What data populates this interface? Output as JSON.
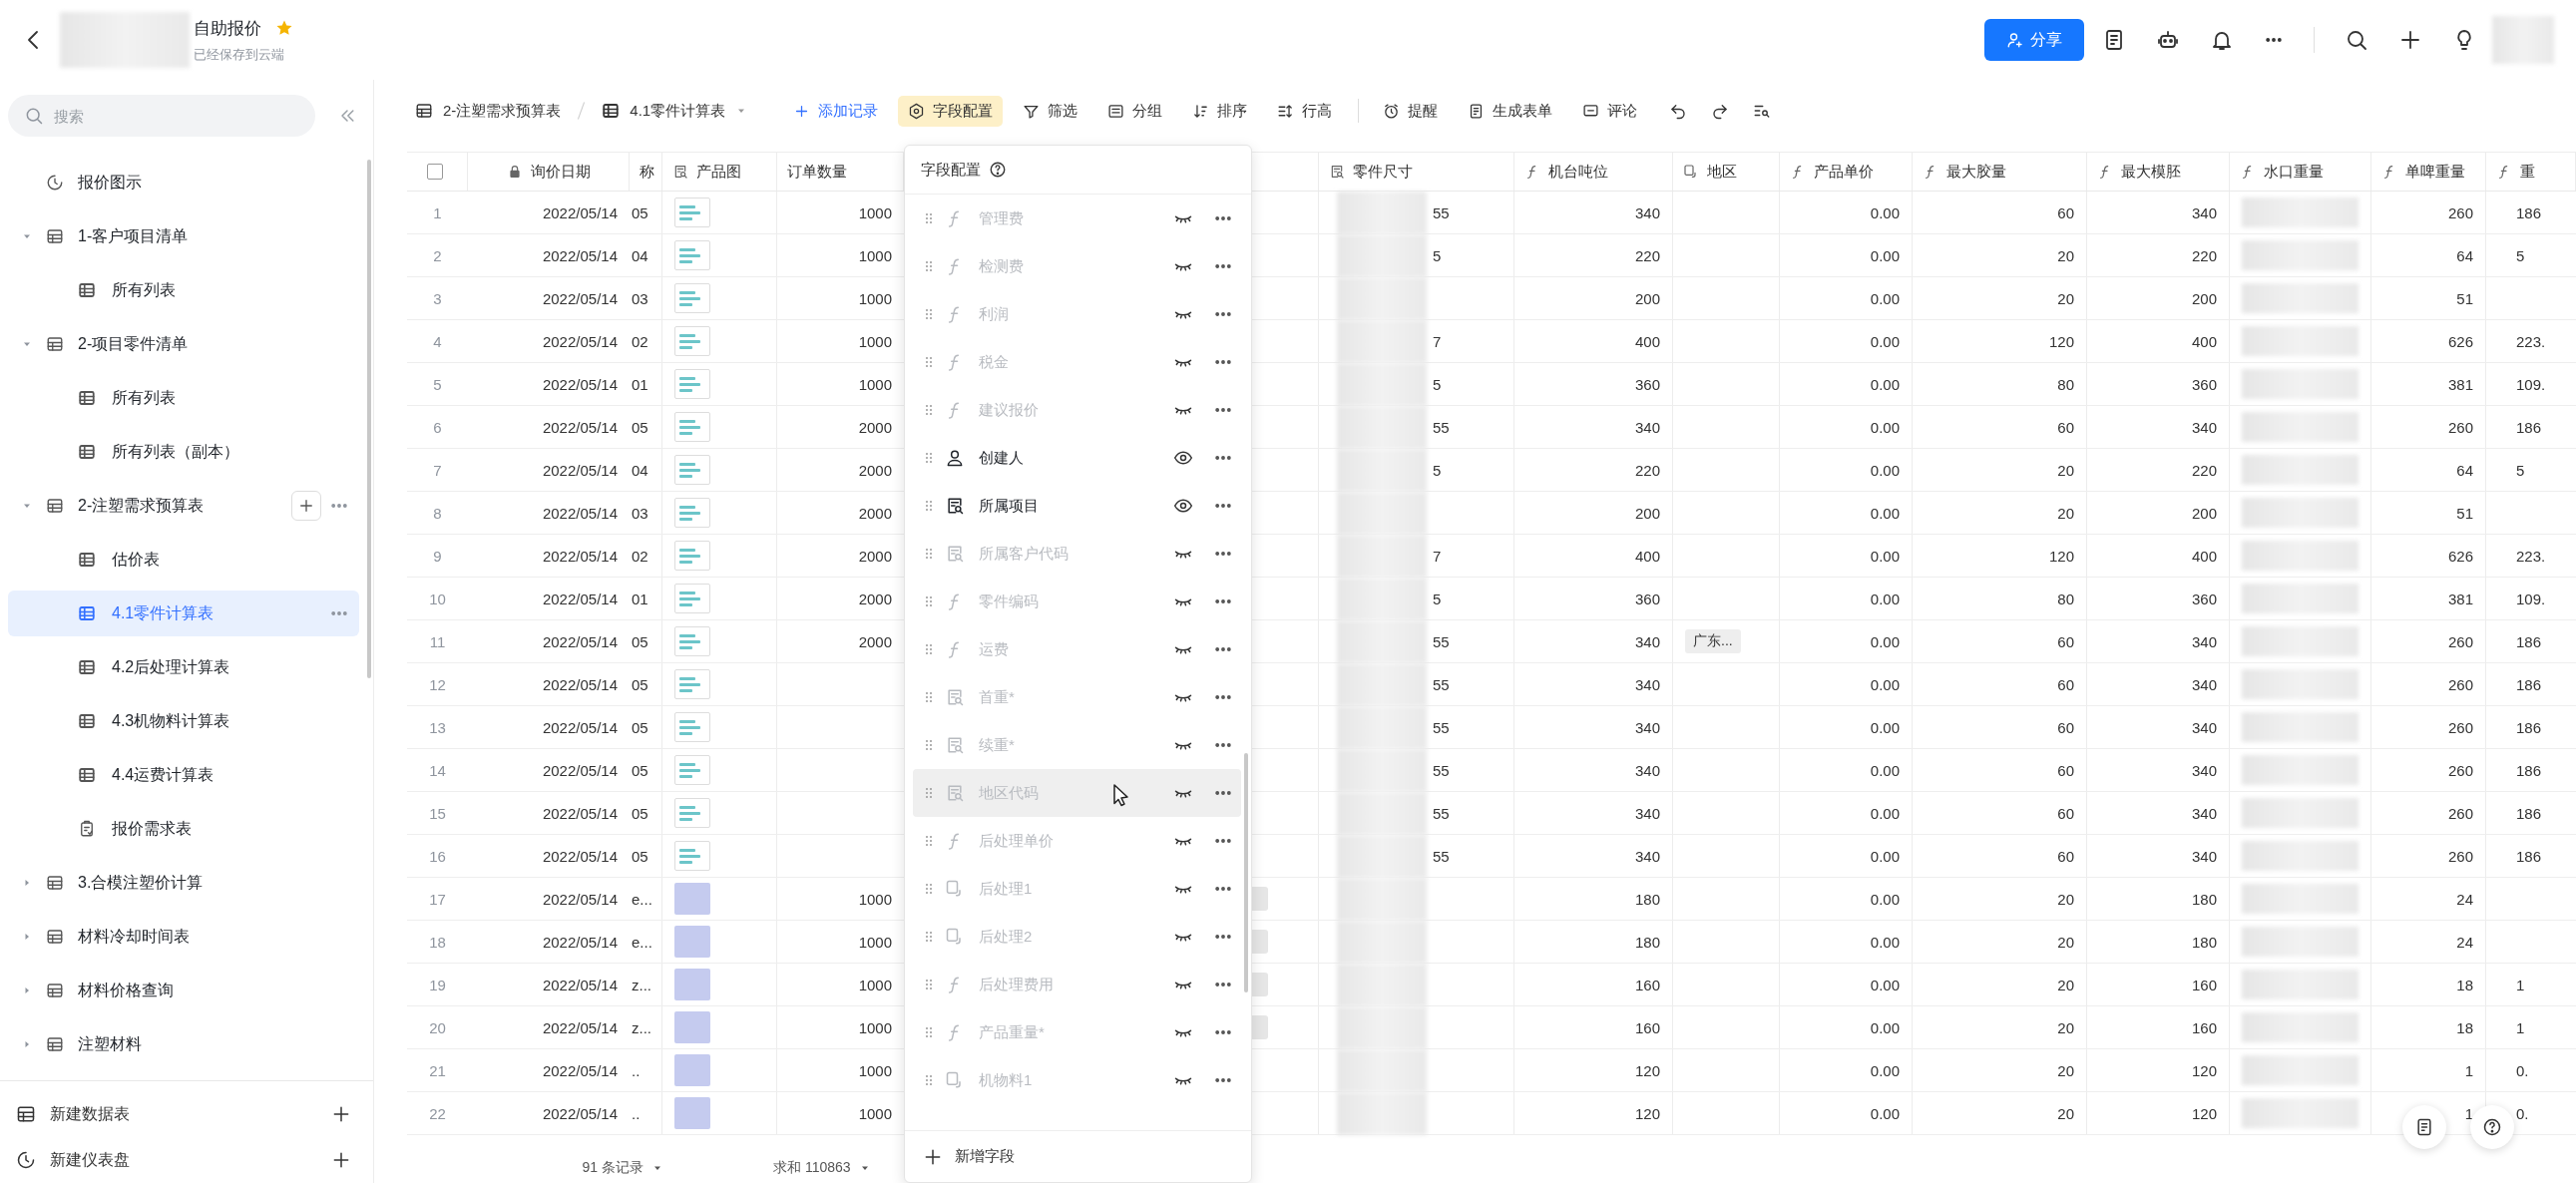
{
  "topbar": {
    "title": "自助报价",
    "starred": true,
    "subtitle": "已经保存到云端",
    "share_button": "分享"
  },
  "sidebar": {
    "search": {
      "placeholder": "搜索"
    },
    "items": [
      {
        "label": "报价图示",
        "kind": "dashboard",
        "selected": false,
        "hovered": false
      },
      {
        "label": "1-客户项目清单",
        "kind": "table",
        "expanded": true,
        "selected": false,
        "hovered": false,
        "children": [
          {
            "label": "所有列表",
            "kind": "view",
            "selected": false,
            "hovered": false
          }
        ]
      },
      {
        "label": "2-项目零件清单",
        "kind": "table",
        "expanded": true,
        "selected": false,
        "hovered": false,
        "children": [
          {
            "label": "所有列表",
            "kind": "view",
            "selected": false,
            "hovered": false
          },
          {
            "label": "所有列表（副本）",
            "kind": "view",
            "selected": false,
            "hovered": false
          }
        ]
      },
      {
        "label": "2-注塑需求预算表",
        "kind": "table",
        "expanded": true,
        "selected": false,
        "hovered": true,
        "children": [
          {
            "label": "估价表",
            "kind": "view",
            "selected": false,
            "hovered": false
          },
          {
            "label": "4.1零件计算表",
            "kind": "view",
            "selected": true,
            "hovered": false
          },
          {
            "label": "4.2后处理计算表",
            "kind": "view",
            "selected": false,
            "hovered": false
          },
          {
            "label": "4.3机物料计算表",
            "kind": "view",
            "selected": false,
            "hovered": false
          },
          {
            "label": "4.4运费计算表",
            "kind": "view",
            "selected": false,
            "hovered": false
          },
          {
            "label": "报价需求表",
            "kind": "form",
            "selected": false,
            "hovered": false
          }
        ]
      },
      {
        "label": "3.合模注塑价计算",
        "kind": "table",
        "expanded": false,
        "selected": false,
        "hovered": false
      },
      {
        "label": "材料冷却时间表",
        "kind": "table",
        "expanded": false,
        "selected": false,
        "hovered": false
      },
      {
        "label": "材料价格查询",
        "kind": "table",
        "expanded": false,
        "selected": false,
        "hovered": false
      },
      {
        "label": "注塑材料",
        "kind": "table",
        "expanded": false,
        "selected": false,
        "hovered": false
      }
    ],
    "footer": [
      {
        "label": "新建数据表",
        "kind": "table"
      },
      {
        "label": "新建仪表盘",
        "kind": "dashboard"
      }
    ]
  },
  "toolbar": {
    "breadcrumb": [
      {
        "label": "2-注塑需求预算表",
        "kind": "table"
      },
      {
        "label": "4.1零件计算表",
        "kind": "view"
      }
    ],
    "actions": [
      {
        "label": "添加记录",
        "kind": "add",
        "selected": false
      },
      {
        "label": "字段配置",
        "kind": "fields",
        "selected": true
      },
      {
        "label": "筛选",
        "kind": "filter",
        "selected": false
      },
      {
        "label": "分组",
        "kind": "group",
        "selected": false
      },
      {
        "label": "排序",
        "kind": "sort",
        "selected": false
      },
      {
        "label": "行高",
        "kind": "row_height",
        "selected": false
      }
    ],
    "tools": [
      {
        "label": "提醒",
        "kind": "remind",
        "selected": false
      },
      {
        "label": "生成表单",
        "kind": "form",
        "selected": false
      },
      {
        "label": "评论",
        "kind": "comment",
        "selected": false
      }
    ]
  },
  "table": {
    "all_checked": false,
    "columns_left": [
      {
        "label": "询价日期",
        "kind": "lock"
      },
      {
        "label": "称",
        "kind": "plain"
      },
      {
        "label": "产品图",
        "kind": "lookup"
      },
      {
        "label": "订单数量",
        "kind": "plain"
      }
    ],
    "columns_right": [
      {
        "label": "零件尺寸",
        "kind": "lookup"
      },
      {
        "label": "机台吨位",
        "kind": "formula"
      },
      {
        "label": "地区",
        "kind": "attach"
      },
      {
        "label": "产品单价",
        "kind": "formula"
      },
      {
        "label": "最大胶量",
        "kind": "formula"
      },
      {
        "label": "最大模胚",
        "kind": "formula"
      },
      {
        "label": "水口重量",
        "kind": "formula"
      },
      {
        "label": "单啤重量",
        "kind": "formula"
      },
      {
        "label": "重",
        "kind": "formula"
      }
    ],
    "rows": [
      {
        "n": "1",
        "date": "2022/05/14",
        "name": "05",
        "kind": "document",
        "qty": "1000",
        "size": "55",
        "tonnage": "340",
        "price": "0.00",
        "max_shot": "60",
        "max_mold": "340",
        "single_weight": "260",
        "weight": "186",
        "tag": false
      },
      {
        "n": "2",
        "date": "2022/05/14",
        "name": "04",
        "kind": "document",
        "qty": "1000",
        "size": "5",
        "tonnage": "220",
        "price": "0.00",
        "max_shot": "20",
        "max_mold": "220",
        "single_weight": "64",
        "weight": "5",
        "tag": false
      },
      {
        "n": "3",
        "date": "2022/05/14",
        "name": "03",
        "kind": "document",
        "qty": "1000",
        "tonnage": "200",
        "price": "0.00",
        "max_shot": "20",
        "max_mold": "200",
        "single_weight": "51",
        "tag": false
      },
      {
        "n": "4",
        "date": "2022/05/14",
        "name": "02",
        "kind": "document",
        "qty": "1000",
        "size": "7",
        "tonnage": "400",
        "price": "0.00",
        "max_shot": "120",
        "max_mold": "400",
        "single_weight": "626",
        "weight": "223.",
        "tag": false
      },
      {
        "n": "5",
        "date": "2022/05/14",
        "name": "01",
        "kind": "document",
        "qty": "1000",
        "size": "5",
        "tonnage": "360",
        "price": "0.00",
        "max_shot": "80",
        "max_mold": "360",
        "single_weight": "381",
        "weight": "109.",
        "tag": false
      },
      {
        "n": "6",
        "date": "2022/05/14",
        "name": "05",
        "kind": "document",
        "qty": "2000",
        "size": "55",
        "tonnage": "340",
        "price": "0.00",
        "max_shot": "60",
        "max_mold": "340",
        "single_weight": "260",
        "weight": "186",
        "tag": false
      },
      {
        "n": "7",
        "date": "2022/05/14",
        "name": "04",
        "kind": "document",
        "qty": "2000",
        "size": "5",
        "tonnage": "220",
        "price": "0.00",
        "max_shot": "20",
        "max_mold": "220",
        "single_weight": "64",
        "weight": "5",
        "tag": false
      },
      {
        "n": "8",
        "date": "2022/05/14",
        "name": "03",
        "kind": "document",
        "qty": "2000",
        "tonnage": "200",
        "price": "0.00",
        "max_shot": "20",
        "max_mold": "200",
        "single_weight": "51",
        "tag": false
      },
      {
        "n": "9",
        "date": "2022/05/14",
        "name": "02",
        "kind": "document",
        "qty": "2000",
        "size": "7",
        "tonnage": "400",
        "price": "0.00",
        "max_shot": "120",
        "max_mold": "400",
        "single_weight": "626",
        "weight": "223.",
        "tag": false
      },
      {
        "n": "10",
        "date": "2022/05/14",
        "name": "01",
        "kind": "document",
        "qty": "2000",
        "size": "5",
        "tonnage": "360",
        "price": "0.00",
        "max_shot": "80",
        "max_mold": "360",
        "single_weight": "381",
        "weight": "109.",
        "tag": false
      },
      {
        "n": "11",
        "date": "2022/05/14",
        "name": "05",
        "kind": "document",
        "qty": "2000",
        "size": "55",
        "tonnage": "340",
        "region": "广东...",
        "price": "0.00",
        "max_shot": "60",
        "max_mold": "340",
        "single_weight": "260",
        "weight": "186",
        "tag": false
      },
      {
        "n": "12",
        "date": "2022/05/14",
        "name": "05",
        "kind": "document",
        "size": "55",
        "tonnage": "340",
        "price": "0.00",
        "max_shot": "60",
        "max_mold": "340",
        "single_weight": "260",
        "weight": "186",
        "tag": false
      },
      {
        "n": "13",
        "date": "2022/05/14",
        "name": "05",
        "kind": "document",
        "size": "55",
        "tonnage": "340",
        "price": "0.00",
        "max_shot": "60",
        "max_mold": "340",
        "single_weight": "260",
        "weight": "186",
        "tag": false
      },
      {
        "n": "14",
        "date": "2022/05/14",
        "name": "05",
        "kind": "document",
        "size": "55",
        "tonnage": "340",
        "price": "0.00",
        "max_shot": "60",
        "max_mold": "340",
        "single_weight": "260",
        "weight": "186",
        "tag": false
      },
      {
        "n": "15",
        "date": "2022/05/14",
        "name": "05",
        "kind": "document",
        "size": "55",
        "tonnage": "340",
        "price": "0.00",
        "max_shot": "60",
        "max_mold": "340",
        "single_weight": "260",
        "weight": "186",
        "tag": false
      },
      {
        "n": "16",
        "date": "2022/05/14",
        "name": "05",
        "kind": "document",
        "size": "55",
        "tonnage": "340",
        "price": "0.00",
        "max_shot": "60",
        "max_mold": "340",
        "single_weight": "260",
        "weight": "186",
        "tag": false
      },
      {
        "n": "17",
        "date": "2022/05/14",
        "name": "e...",
        "kind": "photo",
        "qty": "1000",
        "tonnage": "180",
        "price": "0.00",
        "max_shot": "20",
        "max_mold": "180",
        "single_weight": "24",
        "tag": true
      },
      {
        "n": "18",
        "date": "2022/05/14",
        "name": "e...",
        "kind": "photo",
        "qty": "1000",
        "tonnage": "180",
        "price": "0.00",
        "max_shot": "20",
        "max_mold": "180",
        "single_weight": "24",
        "tag": true
      },
      {
        "n": "19",
        "date": "2022/05/14",
        "name": "z...",
        "kind": "photo",
        "qty": "1000",
        "tonnage": "160",
        "price": "0.00",
        "max_shot": "20",
        "max_mold": "160",
        "single_weight": "18",
        "weight": "1",
        "tag": true
      },
      {
        "n": "20",
        "date": "2022/05/14",
        "name": "z...",
        "kind": "photo",
        "qty": "1000",
        "tonnage": "160",
        "price": "0.00",
        "max_shot": "20",
        "max_mold": "160",
        "single_weight": "18",
        "weight": "1",
        "tag": true
      },
      {
        "n": "21",
        "date": "2022/05/14",
        "name": "..",
        "kind": "photo",
        "qty": "1000",
        "tonnage": "120",
        "price": "0.00",
        "max_shot": "20",
        "max_mold": "120",
        "single_weight": "1",
        "weight": "0.",
        "tag": false
      },
      {
        "n": "22",
        "date": "2022/05/14",
        "name": "..",
        "kind": "photo",
        "qty": "1000",
        "tonnage": "120",
        "price": "0.00",
        "max_shot": "20",
        "max_mold": "120",
        "single_weight": "1",
        "weight": "0.",
        "tag": false
      }
    ],
    "footer": {
      "count": "91 条记录",
      "sum": "求和 110863"
    }
  },
  "field_panel": {
    "title": "字段配置",
    "fields": [
      {
        "label": "管理费",
        "kind": "formula",
        "visible": false,
        "hovered": false
      },
      {
        "label": "检测费",
        "kind": "formula",
        "visible": false,
        "hovered": false
      },
      {
        "label": "利润",
        "kind": "formula",
        "visible": false,
        "hovered": false
      },
      {
        "label": "税金",
        "kind": "formula",
        "visible": false,
        "hovered": false
      },
      {
        "label": "建议报价",
        "kind": "formula",
        "visible": false,
        "hovered": false
      },
      {
        "label": "创建人",
        "kind": "person",
        "visible": true,
        "hovered": false
      },
      {
        "label": "所属项目",
        "kind": "lookup",
        "visible": true,
        "hovered": false
      },
      {
        "label": "所属客户代码",
        "kind": "lookup",
        "visible": false,
        "hovered": false
      },
      {
        "label": "零件编码",
        "kind": "formula",
        "visible": false,
        "hovered": false
      },
      {
        "label": "运费",
        "kind": "formula",
        "visible": false,
        "hovered": false
      },
      {
        "label": "首重*",
        "kind": "lookup",
        "visible": false,
        "hovered": false
      },
      {
        "label": "续重*",
        "kind": "lookup",
        "visible": false,
        "hovered": false
      },
      {
        "label": "地区代码",
        "kind": "lookup",
        "visible": false,
        "hovered": true
      },
      {
        "label": "后处理单价",
        "kind": "formula",
        "visible": false,
        "hovered": false
      },
      {
        "label": "后处理1",
        "kind": "attach",
        "visible": false,
        "hovered": false
      },
      {
        "label": "后处理2",
        "kind": "attach",
        "visible": false,
        "hovered": false
      },
      {
        "label": "后处理费用",
        "kind": "formula",
        "visible": false,
        "hovered": false
      },
      {
        "label": "产品重量*",
        "kind": "formula",
        "visible": false,
        "hovered": false
      },
      {
        "label": "机物料1",
        "kind": "attach",
        "visible": false,
        "hovered": false
      }
    ],
    "add_button": "新增字段"
  }
}
